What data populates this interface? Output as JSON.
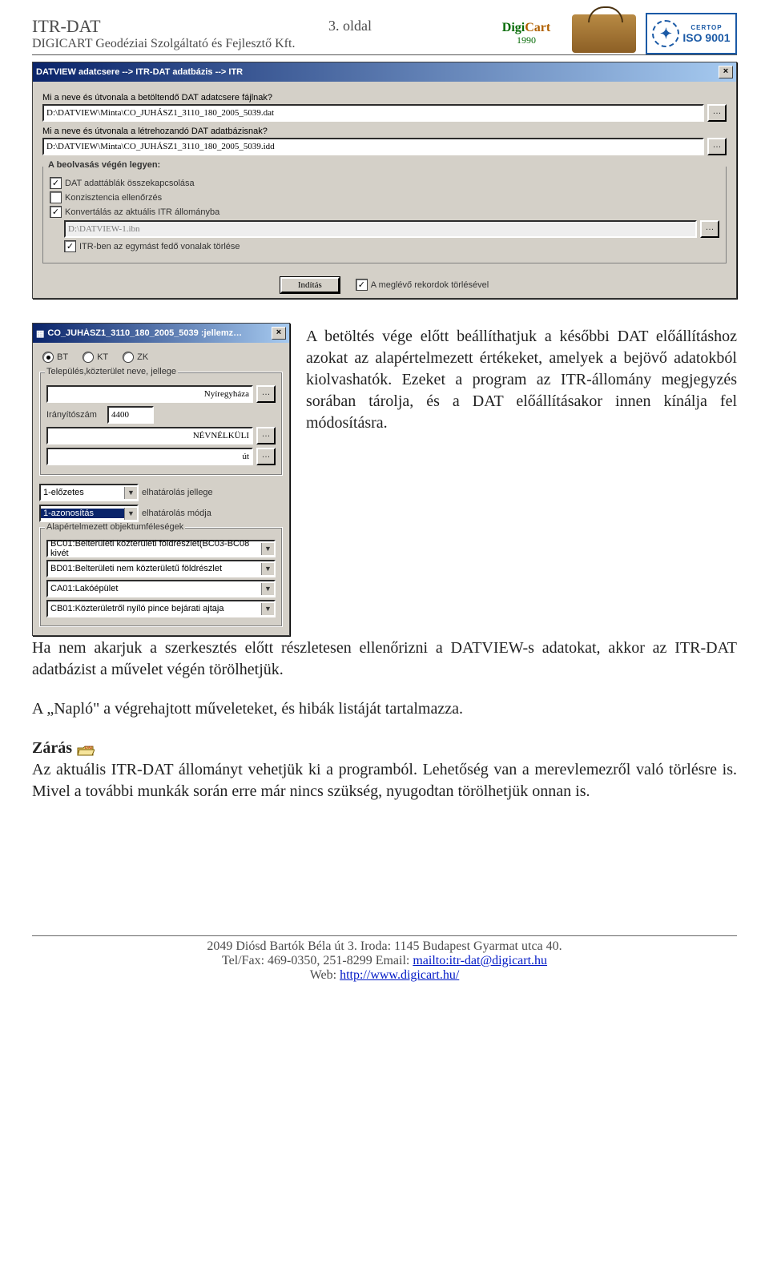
{
  "header": {
    "title": "ITR-DAT",
    "subtitle": "DIGICART Geodéziai Szolgáltató és Fejlesztő Kft.",
    "page_label": "3. oldal",
    "logo_digicart_year": "1990",
    "logo_iso_text": "ISO 9001",
    "logo_iso_certop": "CERTOP"
  },
  "dialog1": {
    "title": "DATVIEW adatcsere --> ITR-DAT adatbázis --> ITR",
    "label_file": "Mi a neve és útvonala a betöltendő DAT adatcsere fájlnak?",
    "path_file": "D:\\DATVIEW\\Minta\\CO_JUHÁSZ1_3110_180_2005_5039.dat",
    "label_db": "Mi a neve és útvonala a létrehozandó DAT adatbázisnak?",
    "path_db": "D:\\DATVIEW\\Minta\\CO_JUHÁSZ1_3110_180_2005_5039.idd",
    "group_title": "A beolvasás végén legyen:",
    "chk1": {
      "checked": true,
      "label": "DAT adattáblák összekapcsolása"
    },
    "chk2": {
      "checked": false,
      "label": "Konzisztencia ellenőrzés"
    },
    "chk3": {
      "checked": true,
      "label": "Konvertálás az aktuális ITR állományba"
    },
    "itr_path": "D:\\DATVIEW-1.ibn",
    "chk4": {
      "checked": true,
      "label": "ITR-ben az egymást fedő vonalak törlése"
    },
    "button_run": "Indítás",
    "chk_delete": {
      "checked": true,
      "label": "A meglévő rekordok törlésével"
    }
  },
  "dialog2": {
    "title": "CO_JUHÁSZ1_3110_180_2005_5039 :jellemz…",
    "radios": {
      "bt": "BT",
      "kt": "KT",
      "zk": "ZK"
    },
    "group1_title": "Település,közterület neve, jellege",
    "fields": {
      "town": "Nyíregyháza",
      "irsz_label": "Irányítószám",
      "irsz": "4400",
      "noname": "NÉVNÉLKÜLI",
      "noname_sub": "út"
    },
    "elhat_jellege_value": "1-előzetes",
    "elhat_jellege_label": "elhatárolás jellege",
    "elhat_modja_value": "1-azonosítás",
    "elhat_modja_label": "elhatárolás módja",
    "group2_title": "Alapértelmezett objektumféleségek",
    "combos": [
      "BC01:Belterületi közterületi földrészlet(BC03-BC08 kivét",
      "BD01:Belterületi nem közterületű földrészlet",
      "CA01:Lakóépület",
      "CB01:Közterületről nyíló pince bejárati ajtaja"
    ]
  },
  "body": {
    "p1": "A betöltés vége előtt beállíthatjuk a későbbi DAT előállításhoz azokat az alapértelmezett értékeket, amelyek a bejövő adatokból kiolvashatók. Ezeket a program az ITR-állomány megjegyzés sorában tárolja, és a DAT előállításakor innen kínálja fel módosításra.",
    "p2": "Ha nem akarjuk a szerkesztés előtt részletesen ellenőrizni a DATVIEW-s adatokat, akkor az ITR-DAT adatbázist a művelet végén törölhetjük.",
    "p3": "A „Napló\" a végrehajtott műveleteket, és hibák listáját tartalmazza.",
    "zaras_head": "Zárás",
    "p4": "Az aktuális ITR-DAT állományt vehetjük ki a programból.  Lehetőség van a merevlemezről való törlésre is. Mivel a további munkák során erre már nincs szükség, nyugodtan törölhetjük onnan is."
  },
  "footer": {
    "line1": "2049 Diósd Bartók Béla út 3. Iroda: 1145 Budapest Gyarmat utca 40.",
    "line2a": "Tel/Fax: 469-0350, 251-8299 Email: ",
    "email": "mailto:itr-dat@digicart.hu",
    "line3a": "Web: ",
    "web": "http://www.digicart.hu/"
  }
}
